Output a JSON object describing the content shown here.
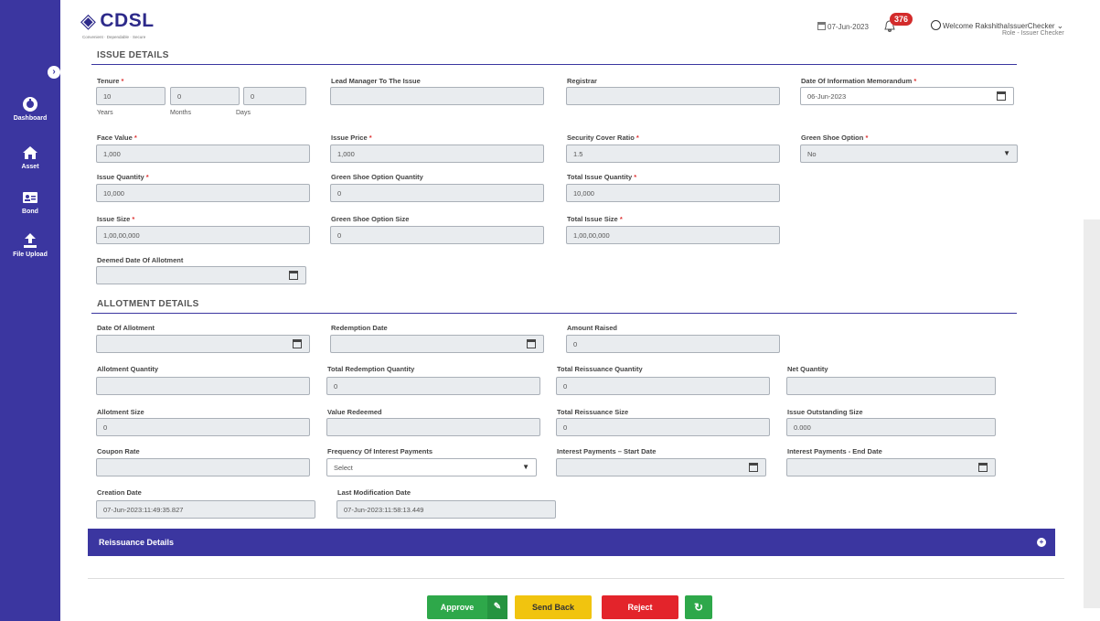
{
  "brand": {
    "name": "CDSL",
    "tagline": "Convenient · Dependable · Secure"
  },
  "header": {
    "date": "07-Jun-2023",
    "notification_count": "376",
    "welcome": "Welcome RakshithaIssuerChecker",
    "role": "Role - Issuer Checker"
  },
  "sidebar": {
    "items": [
      {
        "label": "Dashboard",
        "icon": "dashboard-icon"
      },
      {
        "label": "Asset",
        "icon": "home-icon"
      },
      {
        "label": "Bond",
        "icon": "id-card-icon"
      },
      {
        "label": "File Upload",
        "icon": "upload-icon"
      }
    ]
  },
  "issue_details": {
    "title": "ISSUE DETAILS",
    "tenure": {
      "label": "Tenure",
      "years": "10",
      "months": "0",
      "days": "0",
      "years_label": "Years",
      "months_label": "Months",
      "days_label": "Days"
    },
    "lead_manager": {
      "label": "Lead Manager To The Issue",
      "value": ""
    },
    "registrar": {
      "label": "Registrar",
      "value": ""
    },
    "date_info_memo": {
      "label": "Date Of Information Memorandum",
      "value": "06-Jun-2023"
    },
    "face_value": {
      "label": "Face Value",
      "value": "1,000"
    },
    "issue_price": {
      "label": "Issue Price",
      "value": "1,000"
    },
    "security_cover_ratio": {
      "label": "Security Cover Ratio",
      "value": "1.5"
    },
    "green_shoe_option": {
      "label": "Green Shoe Option",
      "value": "No"
    },
    "issue_quantity": {
      "label": "Issue Quantity",
      "value": "10,000"
    },
    "green_shoe_qty": {
      "label": "Green Shoe Option Quantity",
      "value": "0"
    },
    "total_issue_qty": {
      "label": "Total Issue Quantity",
      "value": "10,000"
    },
    "issue_size": {
      "label": "Issue Size",
      "value": "1,00,00,000"
    },
    "green_shoe_size": {
      "label": "Green Shoe Option Size",
      "value": "0"
    },
    "total_issue_size": {
      "label": "Total Issue Size",
      "value": "1,00,00,000"
    },
    "deemed_date": {
      "label": "Deemed Date Of Allotment",
      "value": ""
    }
  },
  "allotment_details": {
    "title": "ALLOTMENT DETAILS",
    "date_of_allotment": {
      "label": "Date Of Allotment",
      "value": ""
    },
    "redemption_date": {
      "label": "Redemption Date",
      "value": ""
    },
    "amount_raised": {
      "label": "Amount Raised",
      "value": "0"
    },
    "allotment_quantity": {
      "label": "Allotment Quantity",
      "value": ""
    },
    "total_redemption_qty": {
      "label": "Total Redemption Quantity",
      "value": "0"
    },
    "total_reissuance_qty": {
      "label": "Total Reissuance Quantity",
      "value": "0"
    },
    "net_quantity": {
      "label": "Net Quantity",
      "value": ""
    },
    "allotment_size": {
      "label": "Allotment Size",
      "value": "0"
    },
    "value_redeemed": {
      "label": "Value Redeemed",
      "value": ""
    },
    "total_reissuance_size": {
      "label": "Total Reissuance Size",
      "value": "0"
    },
    "issue_outstanding_size": {
      "label": "Issue Outstanding Size",
      "value": "0.000"
    },
    "coupon_rate": {
      "label": "Coupon Rate",
      "value": ""
    },
    "frequency": {
      "label": "Frequency Of Interest Payments",
      "value": "Select"
    },
    "ip_start": {
      "label": "Interest Payments – Start Date",
      "value": ""
    },
    "ip_end": {
      "label": "Interest Payments - End Date",
      "value": ""
    },
    "creation_date": {
      "label": "Creation Date",
      "value": "07-Jun-2023:11:49:35.827"
    },
    "last_mod_date": {
      "label": "Last Modification Date",
      "value": "07-Jun-2023:11:58:13.449"
    }
  },
  "reissuance": {
    "title": "Reissuance Details"
  },
  "actions": {
    "approve": "Approve",
    "send_back": "Send Back",
    "reject": "Reject"
  },
  "colors": {
    "primary": "#3b36a0",
    "approve": "#2ea84a",
    "send_back": "#f1c40f",
    "reject": "#e3242b"
  }
}
